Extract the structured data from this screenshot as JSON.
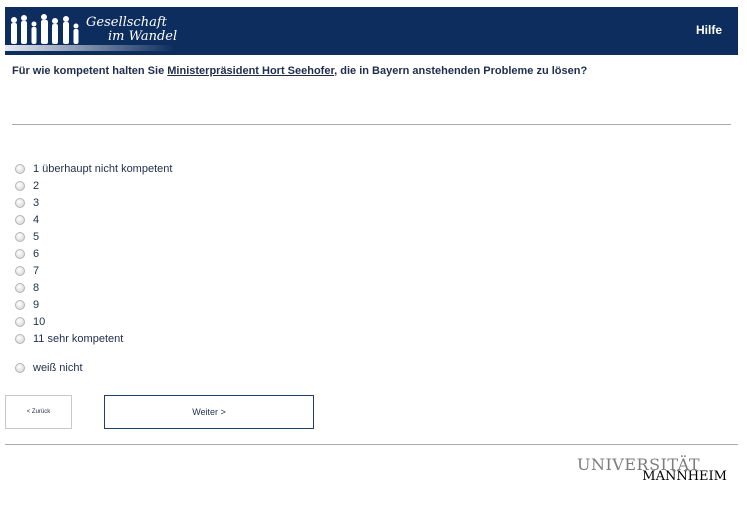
{
  "header": {
    "logo_line1": "Gesellschaft",
    "logo_line2": "im Wandel",
    "help_label": "Hilfe",
    "colors": {
      "background": "#0d2d5e",
      "text": "#ffffff"
    }
  },
  "question": {
    "prefix": "Für wie kompetent halten Sie ",
    "link_text": "Ministerpräsident Hort Seehofer",
    "suffix": ", die in Bayern anstehenden Probleme zu lösen?"
  },
  "options": [
    {
      "label": "1 überhaupt nicht kompetent"
    },
    {
      "label": "2"
    },
    {
      "label": "3"
    },
    {
      "label": "4"
    },
    {
      "label": "5"
    },
    {
      "label": "6"
    },
    {
      "label": "7"
    },
    {
      "label": "8"
    },
    {
      "label": "9"
    },
    {
      "label": "10"
    },
    {
      "label": "11 sehr kompetent"
    },
    {
      "label": "weiß nicht"
    }
  ],
  "nav": {
    "back_label": "< Zurück",
    "next_label": "Weiter >"
  },
  "footer": {
    "uni_line1": "UNIVERSITÄT",
    "uni_line2": "MANNHEIM"
  },
  "icons": [
    "people-silhouette-icon",
    "radio-icon"
  ]
}
